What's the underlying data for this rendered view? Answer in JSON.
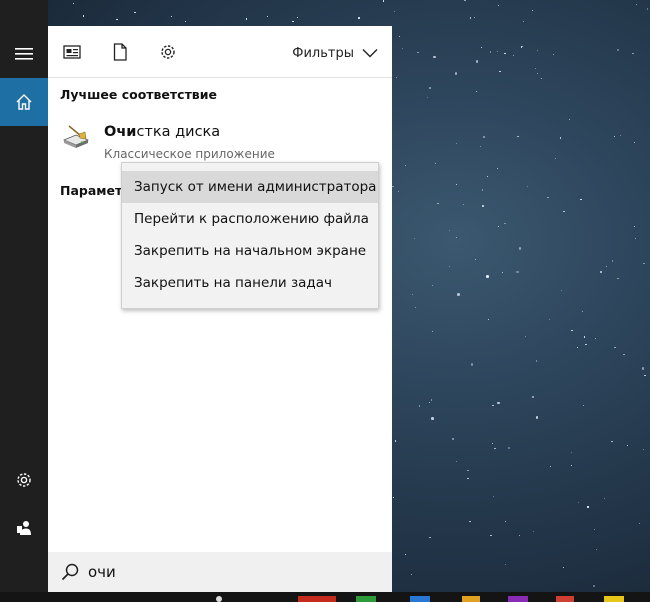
{
  "toolbar": {
    "icons": [
      "news-icon",
      "document-icon",
      "gear-icon"
    ],
    "filters_label": "Фильтры"
  },
  "best_match": {
    "heading": "Лучшее соответствие",
    "result_title_bold": "Очи",
    "result_title_rest": "стка диска",
    "result_subtitle": "Классическое приложение",
    "icon": "disk-cleanup-icon"
  },
  "params": {
    "heading": "Параметры"
  },
  "context_menu": {
    "items": [
      "Запуск от имени администратора",
      "Перейти к расположению файла",
      "Закрепить на начальном экране",
      "Закрепить на панели задач"
    ],
    "highlighted_index": 0
  },
  "search": {
    "query": "очи",
    "icon": "search-icon"
  },
  "rail": {
    "icons": [
      "hamburger-icon",
      "home-icon",
      "settings-icon",
      "user-icon"
    ]
  },
  "colors": {
    "accent": "#1e6fa3",
    "rail": "#1f1f1f",
    "menu_bg": "#f2f2f2",
    "menu_highlight": "#d9d9d9"
  }
}
